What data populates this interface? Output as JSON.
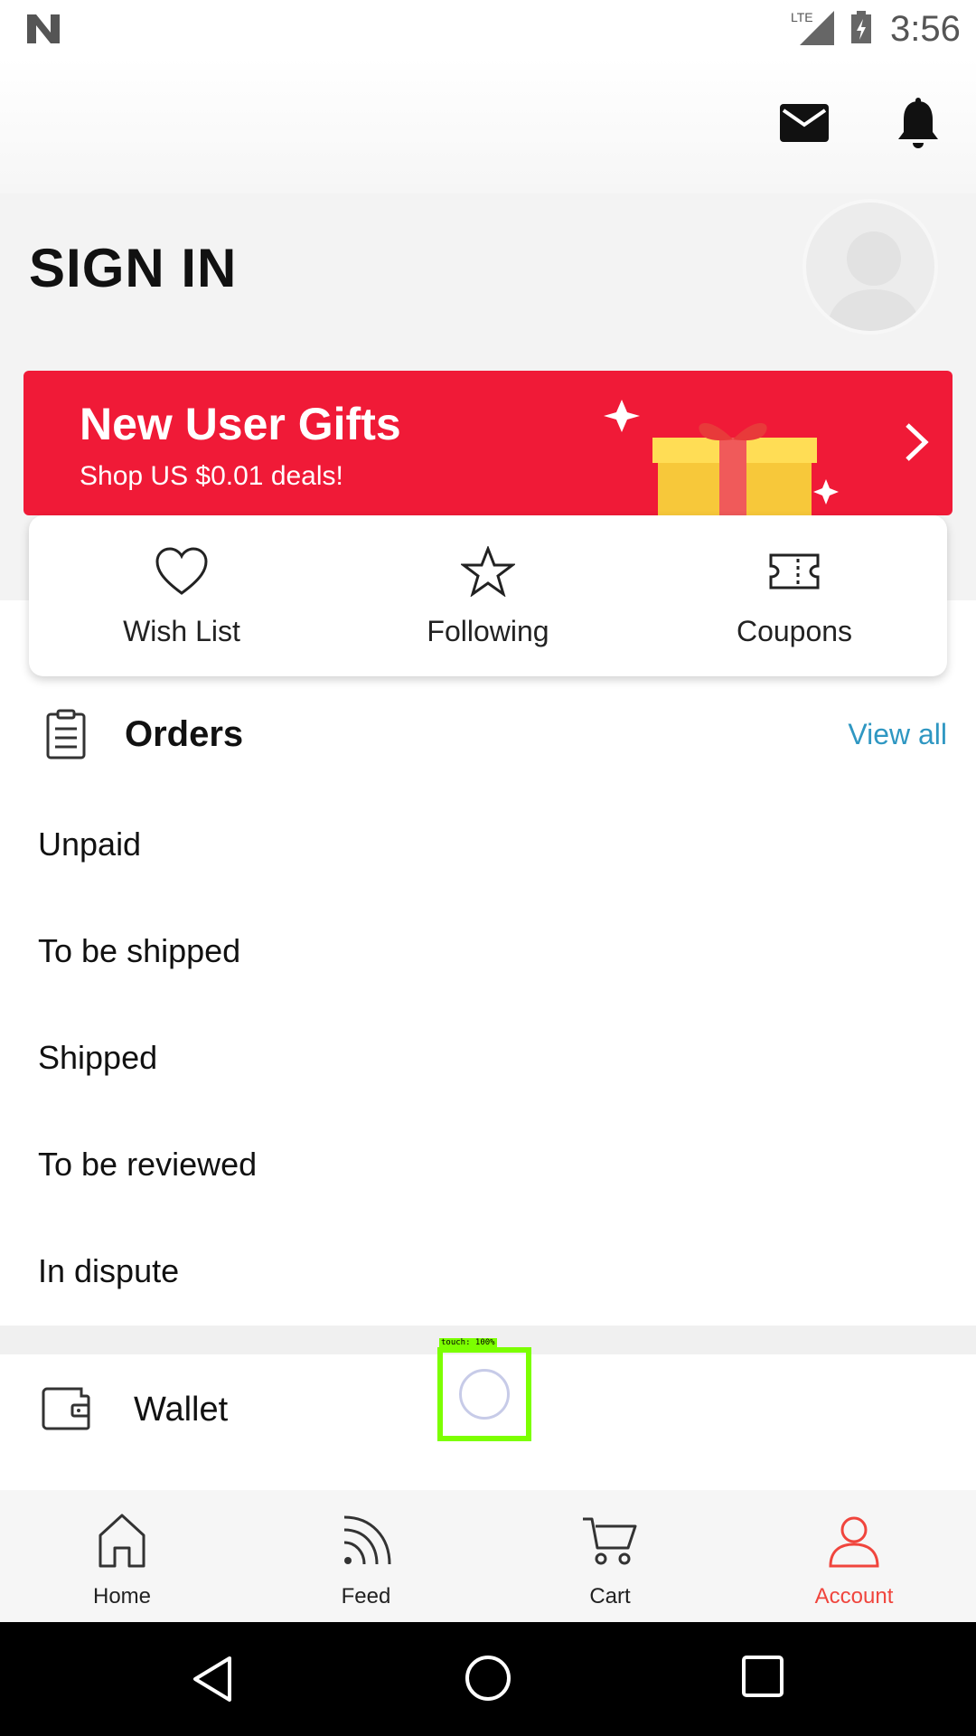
{
  "status_bar": {
    "network": "LTE",
    "time": "3:56"
  },
  "header": {
    "title": "SIGN IN"
  },
  "banner": {
    "title": "New User Gifts",
    "subtitle": "Shop US $0.01 deals!"
  },
  "quick_links": [
    {
      "label": "Wish List",
      "icon": "heart-icon"
    },
    {
      "label": "Following",
      "icon": "star-icon"
    },
    {
      "label": "Coupons",
      "icon": "ticket-icon"
    }
  ],
  "orders": {
    "title": "Orders",
    "view_all": "View all",
    "items": [
      "Unpaid",
      "To be shipped",
      "Shipped",
      "To be reviewed",
      "In dispute"
    ]
  },
  "wallet": {
    "label": "Wallet"
  },
  "touch_overlay": {
    "label": "touch: 100%"
  },
  "bottom_nav": [
    {
      "label": "Home",
      "icon": "home-icon"
    },
    {
      "label": "Feed",
      "icon": "feed-icon"
    },
    {
      "label": "Cart",
      "icon": "cart-icon"
    },
    {
      "label": "Account",
      "icon": "account-icon",
      "active": true
    }
  ],
  "colors": {
    "accent": "#f0453d",
    "banner": "#f01a37",
    "link": "#2f97c2"
  }
}
